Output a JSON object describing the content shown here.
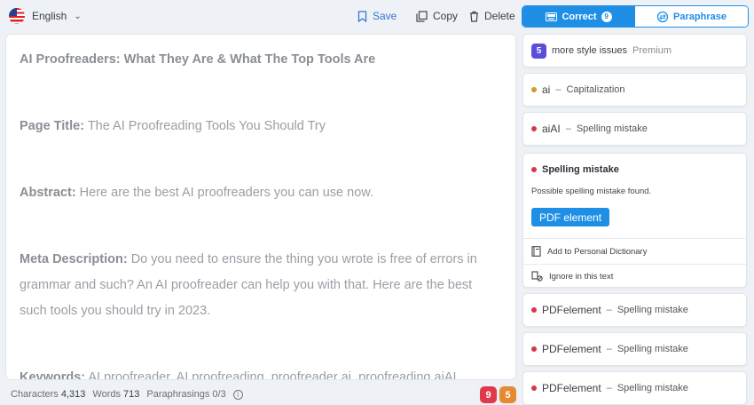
{
  "language": {
    "label": "English"
  },
  "toolbar": {
    "save": "Save",
    "copy": "Copy",
    "delete": "Delete"
  },
  "tabs": {
    "correct": "Correct",
    "correct_count": "9",
    "paraphrase": "Paraphrase"
  },
  "editor": {
    "p1_bold": "AI Proofreaders: What They Are & What The Top Tools Are",
    "p2_label": "Page Title:",
    "p2_text": " The AI Proofreading Tools You Should Try",
    "p3_label": "Abstract:",
    "p3_text": " Here are the best AI proofreaders you can use now.",
    "p4_label": "Meta Description:",
    "p4_text": " Do you need to ensure the thing you wrote is free of errors in grammar and such? An AI proofreader can help you with that. Here are the best such tools you should try in 2023.",
    "p5_label": "Keywords:",
    "p5_text_a": " AI proofreader, AI proofreading, proofreader ",
    "p5_err1": "ai",
    "p5_text_b": ", proofreading ",
    "p5_err2": "aiAI",
    "p5_text_c": ","
  },
  "status": {
    "characters_label": "Characters",
    "characters": "4,313",
    "words_label": "Words",
    "words": "713",
    "paraphrasings": "Paraphrasings 0/3",
    "error_count": "9",
    "style_count": "5"
  },
  "issues": {
    "premium": {
      "count": "5",
      "text": "more style issues",
      "tag": "Premium"
    },
    "i1": {
      "word": "ai",
      "kind": "Capitalization"
    },
    "i2": {
      "word": "aiAI",
      "kind": "Spelling mistake"
    },
    "expanded": {
      "title": "Spelling mistake",
      "desc": "Possible spelling mistake found.",
      "suggestion": "PDF element",
      "add_dict": "Add to Personal Dictionary",
      "ignore": "Ignore in this text"
    },
    "i3": {
      "word": "PDFelement",
      "kind": "Spelling mistake"
    },
    "i4": {
      "word": "PDFelement",
      "kind": "Spelling mistake"
    },
    "i5": {
      "word": "PDFelement",
      "kind": "Spelling mistake"
    },
    "separator": "–"
  },
  "colors": {
    "accent": "#1f8fe6",
    "error": "#d7374b",
    "style": "#d19a2a",
    "premium": "#5b4fd9"
  }
}
